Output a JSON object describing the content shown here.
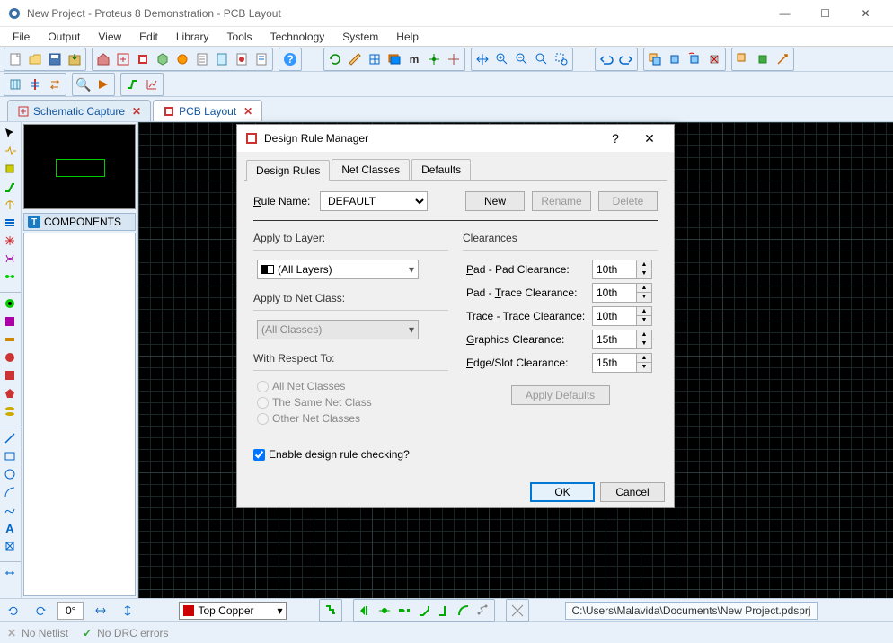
{
  "window": {
    "title": "New Project - Proteus 8 Demonstration - PCB Layout"
  },
  "menu": {
    "items": [
      "File",
      "Output",
      "View",
      "Edit",
      "Library",
      "Tools",
      "Technology",
      "System",
      "Help"
    ]
  },
  "tabs": {
    "schematic": "Schematic Capture",
    "pcb": "PCB Layout"
  },
  "sidebar": {
    "components_label": "COMPONENTS"
  },
  "statusbar": {
    "angle": "0°",
    "layer": "Top Copper",
    "path": "C:\\Users\\Malavida\\Documents\\New Project.pdsprj",
    "netlist": "No Netlist",
    "drc": "No DRC errors"
  },
  "dialog": {
    "title": "Design Rule Manager",
    "tabs": [
      "Design Rules",
      "Net Classes",
      "Defaults"
    ],
    "rule_name_label": "Rule Name:",
    "rule_name_value": "DEFAULT",
    "buttons": {
      "new": "New",
      "rename": "Rename",
      "delete": "Delete"
    },
    "apply_layer_label": "Apply to Layer:",
    "apply_layer_value": "(All Layers)",
    "apply_netclass_label": "Apply to Net Class:",
    "apply_netclass_value": "(All Classes)",
    "respect_label": "With Respect To:",
    "respect_opts": [
      "All Net Classes",
      "The Same Net Class",
      "Other Net Classes"
    ],
    "clearances_label": "Clearances",
    "clearances": {
      "pad_pad": {
        "label": "Pad - Pad Clearance:",
        "value": "10th"
      },
      "pad_trace": {
        "label": "Pad - Trace Clearance:",
        "value": "10th"
      },
      "trace_trace": {
        "label": "Trace - Trace Clearance:",
        "value": "10th"
      },
      "graphics": {
        "label": "Graphics Clearance:",
        "value": "15th"
      },
      "edge": {
        "label": "Edge/Slot Clearance:",
        "value": "15th"
      }
    },
    "apply_defaults": "Apply Defaults",
    "enable_drc": "Enable design rule checking?",
    "ok": "OK",
    "cancel": "Cancel"
  }
}
